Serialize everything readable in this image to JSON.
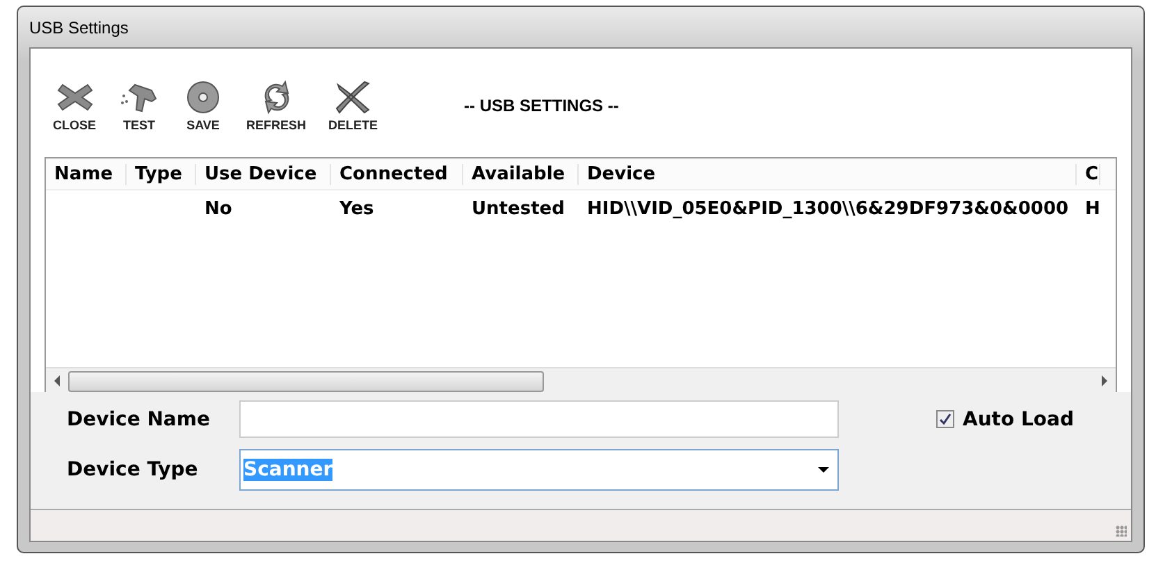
{
  "window": {
    "title": "USB Settings"
  },
  "toolbar": [
    {
      "kind": "close",
      "label": "CLOSE"
    },
    {
      "kind": "test",
      "label": "TEST"
    },
    {
      "kind": "save",
      "label": "SAVE"
    },
    {
      "kind": "refresh",
      "label": "REFRESH"
    },
    {
      "kind": "delete",
      "label": "DELETE"
    }
  ],
  "heading": "-- USB SETTINGS --",
  "table": {
    "columns": [
      "Name",
      "Type",
      "Use Device",
      "Connected",
      "Available",
      "Device",
      "C"
    ],
    "rows": [
      [
        "",
        "",
        "No",
        "Yes",
        "Untested",
        "HID\\\\VID_05E0&PID_1300\\\\6&29DF973&0&0000",
        "H"
      ]
    ]
  },
  "form": {
    "device_name": {
      "label": "Device Name"
    },
    "device_type": {
      "label": "Device Type",
      "value": "Scanner"
    },
    "auto_load": {
      "label": "Auto Load",
      "checked": true
    }
  }
}
